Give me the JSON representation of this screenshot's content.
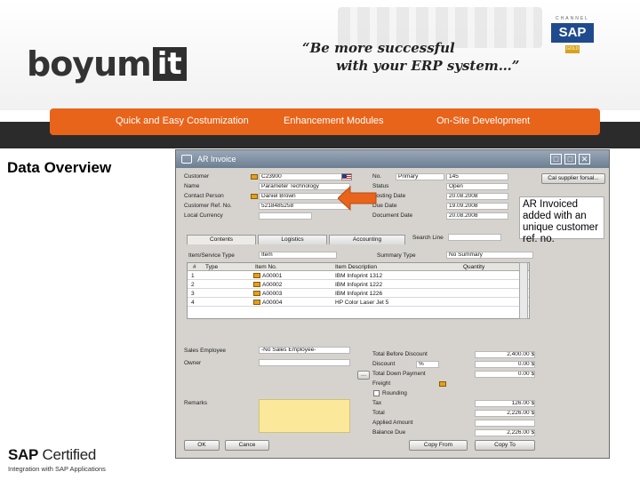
{
  "header": {
    "logo_text": "boyum",
    "logo_box": "it",
    "slogan_line1": "“Be more successful",
    "slogan_line2": "with your ERP system…”",
    "sap_channel": {
      "top": "CHANNEL",
      "mid": "SAP",
      "badge": "GOLD"
    }
  },
  "menu": {
    "items": [
      "Quick and Easy Costumization",
      "Enhancement Modules",
      "On-Site Development"
    ]
  },
  "section_title": "Data Overview",
  "window": {
    "title": "AR Invoice",
    "buttons": [
      "□",
      "□",
      "✕"
    ],
    "left_fields": [
      {
        "label": "Customer",
        "value": "C23900"
      },
      {
        "label": "Name",
        "value": "Parameter Technology"
      },
      {
        "label": "Contact Person",
        "value": "Daniel Brown"
      },
      {
        "label": "Customer Ref. No.",
        "value": "5218485258"
      },
      {
        "label": "Local Currency",
        "value": ""
      }
    ],
    "right_fields": [
      {
        "label": "No.",
        "series": "Primary",
        "value": "145"
      },
      {
        "label": "Status",
        "value": "Open"
      },
      {
        "label": "Posting Date",
        "value": "20.08.2008"
      },
      {
        "label": "Due Date",
        "value": "19.09.2008"
      },
      {
        "label": "Document Date",
        "value": "20.08.2008"
      }
    ],
    "supplier_button": "Cal supplier forsal...",
    "tabs": [
      "Contents",
      "Logistics",
      "Accounting"
    ],
    "search_label": "Search Line",
    "item_type_label": "Item/Service Type",
    "item_type_value": "Item",
    "summary_label": "Summary Type",
    "summary_value": "No Summary",
    "grid": {
      "headers": [
        "#",
        "Type",
        "Item No.",
        "Item Description",
        "Quantity"
      ],
      "rows": [
        {
          "n": "1",
          "item": "A00001",
          "desc": "IBM Infoprint 1312"
        },
        {
          "n": "2",
          "item": "A00002",
          "desc": "IBM Infoprint 1222"
        },
        {
          "n": "3",
          "item": "A00003",
          "desc": "IBM Infoprint 1226"
        },
        {
          "n": "4",
          "item": "A00004",
          "desc": "HP Color Laser Jet 5"
        }
      ]
    },
    "sales_employee_label": "Sales Employee",
    "sales_employee_value": "-No Sales Employee-",
    "owner_label": "Owner",
    "remarks_label": "Remarks",
    "totals": [
      {
        "label": "Total Before Discount",
        "value": "2,400.00 $"
      },
      {
        "label": "Discount",
        "value": "%"
      },
      {
        "label": "Total Down Payment",
        "value": ""
      },
      {
        "label": "Freight",
        "value": ""
      },
      {
        "label": "Rounding",
        "value": ""
      },
      {
        "label": "Tax",
        "value": "126.00 $"
      },
      {
        "label": "Total",
        "value": "2,226.00 $"
      },
      {
        "label": "Applied Amount",
        "value": ""
      },
      {
        "label": "Balance Due",
        "value": "2,226.00 $"
      }
    ],
    "total_values_extra": [
      "0.00 $",
      "0.00 $"
    ],
    "bottom_buttons": {
      "ok": "OK",
      "cancel": "Cance",
      "copy_from": "Copy From",
      "copy_to": "Copy To"
    }
  },
  "callout": "AR Invoiced added with an unique customer ref. no.",
  "footer": {
    "sap": "SAP",
    "certified": " Certified",
    "integration": "Integration with SAP Applications"
  }
}
